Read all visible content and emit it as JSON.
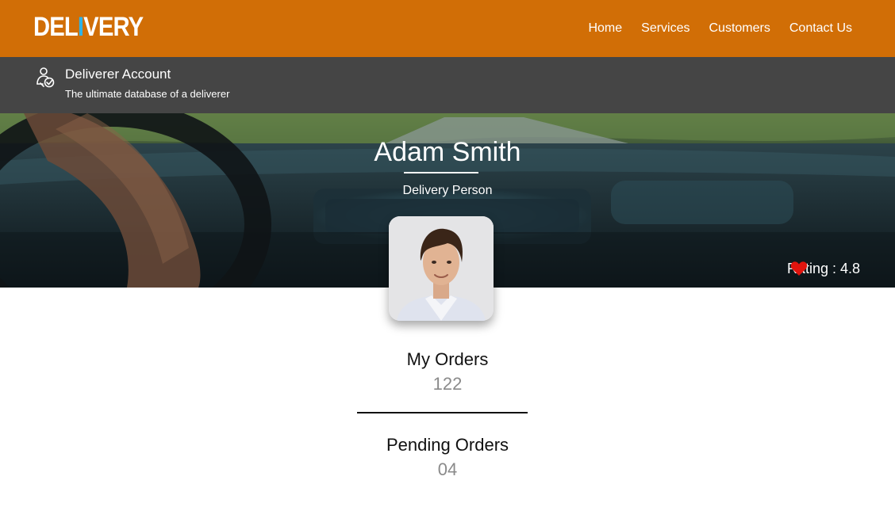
{
  "brand": {
    "logo_pre": "DEL",
    "logo_accent": "I",
    "logo_post": "VERY"
  },
  "nav": {
    "items": [
      {
        "label": "Home"
      },
      {
        "label": "Services"
      },
      {
        "label": "Customers"
      },
      {
        "label": "Contact Us"
      }
    ]
  },
  "account": {
    "title": "Deliverer Account",
    "tagline": "The ultimate database of a deliverer",
    "icon": "deliverer-user-icon"
  },
  "profile": {
    "name": "Adam Smith",
    "role": "Delivery Person",
    "rating_label": "Rating : 4.8",
    "rating_icon": "heart-icon"
  },
  "stats": [
    {
      "label": "My Orders",
      "value": "122"
    },
    {
      "label": "Pending Orders",
      "value": "04"
    }
  ],
  "colors": {
    "primary": "#d16e06",
    "subbar": "#454545",
    "logo_accent": "#2fb3e6",
    "heart": "#e0140e",
    "stat_value": "#8a8a8a"
  }
}
